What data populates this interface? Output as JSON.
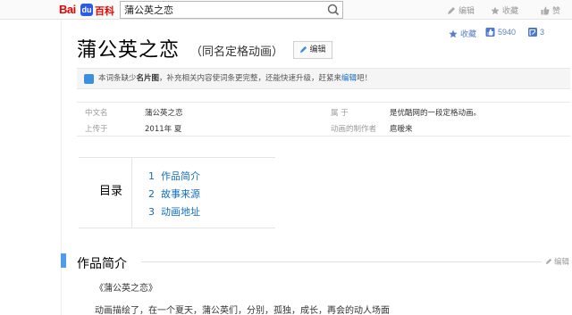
{
  "header": {
    "logo": {
      "bai": "Bai",
      "du": "du",
      "baike": "百科"
    },
    "search_value": "蒲公英之恋",
    "actions": [
      {
        "icon": "pencil-icon",
        "label": "编辑"
      },
      {
        "icon": "star-icon",
        "label": "收藏"
      },
      {
        "icon": "thumb-up-icon",
        "label": "赞"
      }
    ]
  },
  "title": {
    "main": "蒲公英之恋",
    "subtitle": "（同名定格动画）",
    "edit_label": "编辑"
  },
  "stats": {
    "collect_label": "收藏",
    "like_count": "5940",
    "share_count": "3"
  },
  "notice": {
    "before": "本词条缺少",
    "missing": "名片图",
    "middle": "，补充相关内容使词条更完整，还能快速升级，赶紧来",
    "link": "编辑",
    "after": "吧！"
  },
  "basic_info": {
    "left": [
      {
        "key": "中文名",
        "value": "蒲公英之恋"
      },
      {
        "key": "上传于",
        "value": "2011年 夏"
      }
    ],
    "right": [
      {
        "key": "属 于",
        "value": "是优酷网的一段定格动画。"
      },
      {
        "key": "动画的制作者",
        "value": "扈暧来"
      }
    ]
  },
  "catalog": {
    "label": "目录",
    "items": [
      {
        "num": "1",
        "text": "作品简介"
      },
      {
        "num": "2",
        "text": "故事来源"
      },
      {
        "num": "3",
        "text": "动画地址"
      }
    ]
  },
  "section": {
    "title": "作品简介",
    "edit_label": "编辑",
    "lines": [
      "《蒲公英之恋》",
      "动画描绘了，在一个夏天，蒲公英们，分别，孤独，成长，再会的动人场面"
    ]
  },
  "colors": {
    "accent_blue": "#4f9cee",
    "link_blue": "#136ec2",
    "logo_red": "#e10601"
  }
}
